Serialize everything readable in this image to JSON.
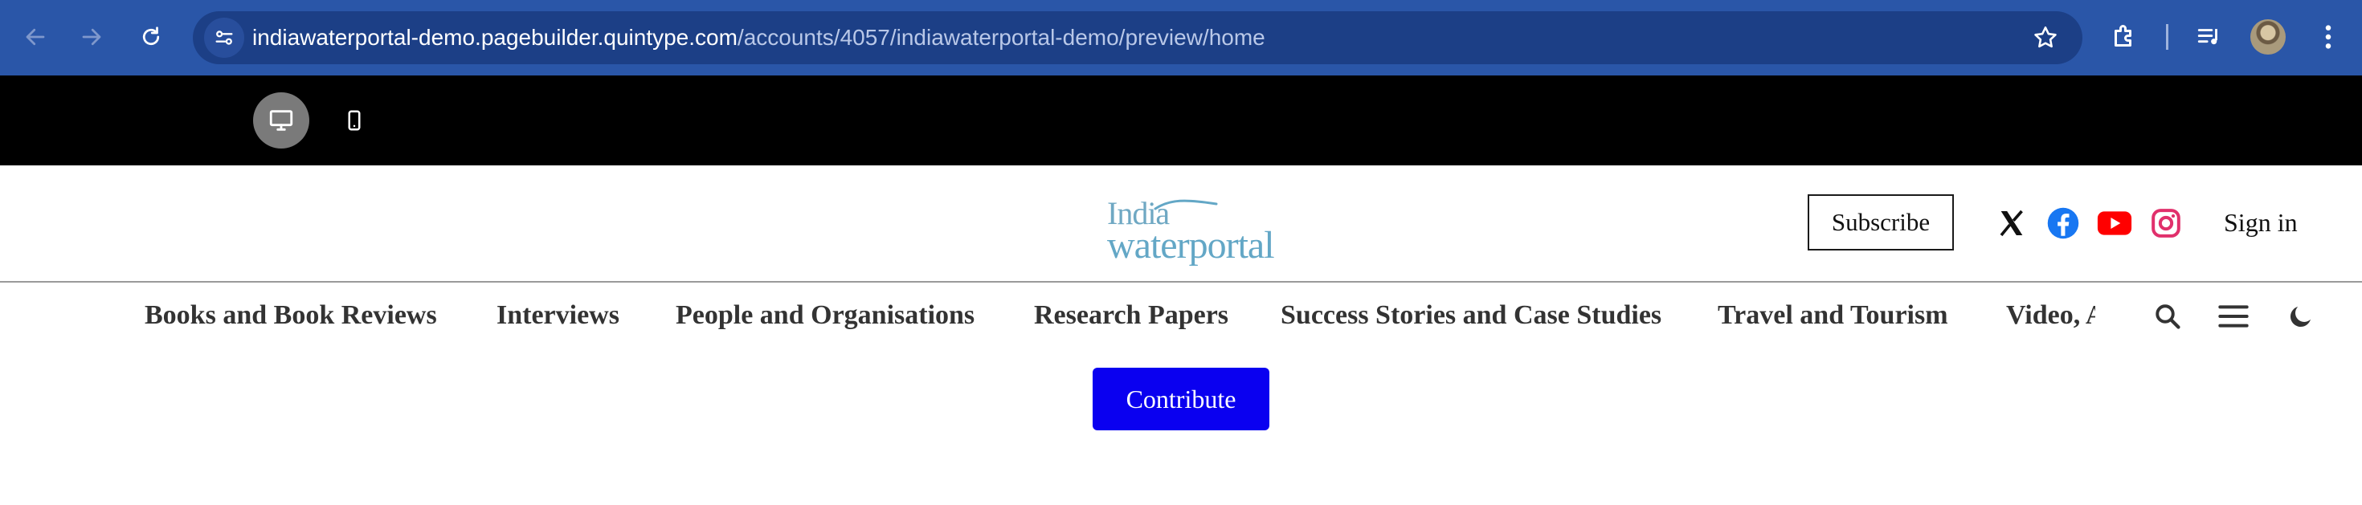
{
  "browser": {
    "url_host": "indiawaterportal-demo.pagebuilder.quintype.com",
    "url_path": "/accounts/4057/indiawaterportal-demo/preview/home",
    "icons": [
      "back-arrow-icon",
      "forward-arrow-icon",
      "reload-icon",
      "site-info-icon",
      "bookmark-star-icon",
      "extensions-icon",
      "media-controls-icon",
      "profile-avatar",
      "more-menu-icon"
    ]
  },
  "preview_toolbar": {
    "devices": [
      "desktop",
      "mobile"
    ],
    "active_device": "desktop"
  },
  "header": {
    "logo_line1": "India",
    "logo_line2": "waterportal",
    "subscribe_label": "Subscribe",
    "social": [
      "x-icon",
      "facebook-icon",
      "youtube-icon",
      "instagram-icon"
    ],
    "signin_label": "Sign in"
  },
  "menu": {
    "items": [
      "Books and Book Reviews",
      "Interviews",
      "People and Organisations",
      "Research Papers",
      "Success Stories and Case Studies",
      "Travel and Tourism",
      "Video, Audio and Multimedia"
    ],
    "tools": [
      "search-icon",
      "hamburger-menu-icon",
      "dark-mode-icon"
    ]
  },
  "contribute_label": "Contribute",
  "colors": {
    "chrome_bg": "#2a56a8",
    "omnibox_bg": "#1c3f86",
    "preview_bar_bg": "#000000",
    "logo_teal": "#63a7c6",
    "contribute_bg": "#0a00f0",
    "facebook": "#1877f2",
    "youtube": "#ff0000",
    "instagram": "#e1306c"
  }
}
